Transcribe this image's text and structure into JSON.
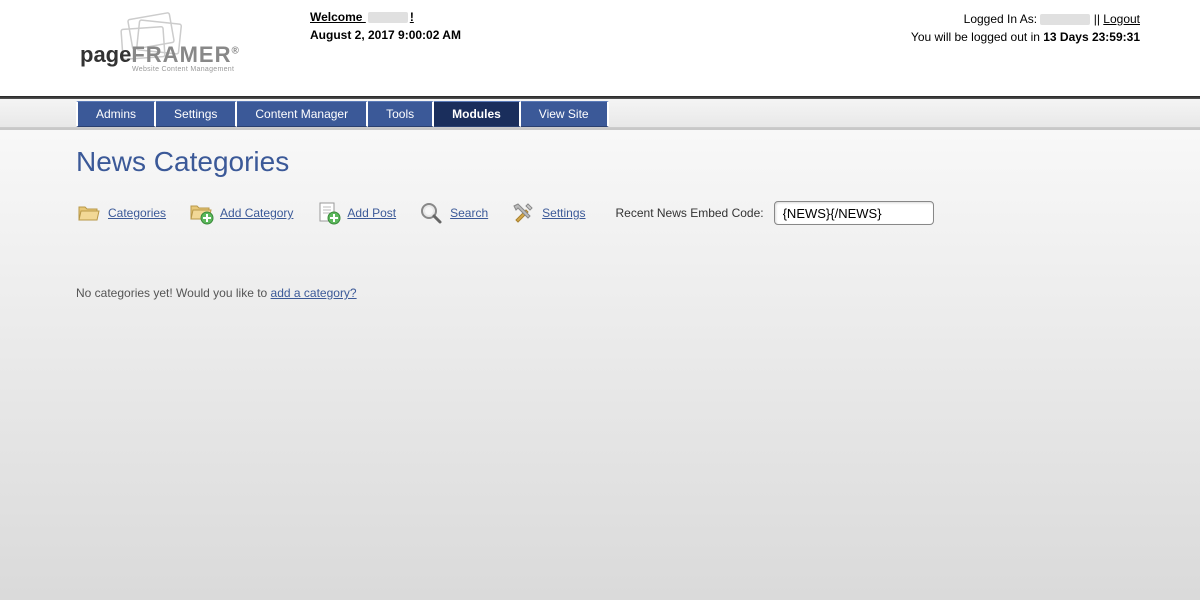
{
  "header": {
    "welcome_prefix": "Welcome ",
    "welcome_suffix": "!",
    "date_time": "August 2, 2017 9:00:02 AM",
    "logged_in_prefix": "Logged In As: ",
    "separator": " || ",
    "logout_label": "Logout",
    "session_prefix": "You will be logged out in ",
    "session_remaining": "13 Days 23:59:31",
    "logo_sub": "Website Content Management"
  },
  "nav": {
    "tabs": [
      {
        "label": "Admins"
      },
      {
        "label": "Settings"
      },
      {
        "label": "Content Manager"
      },
      {
        "label": "Tools"
      },
      {
        "label": "Modules",
        "active": true
      },
      {
        "label": "View Site"
      }
    ]
  },
  "page": {
    "title": "News Categories",
    "toolbar": {
      "categories": "Categories",
      "add_category": "Add Category",
      "add_post": "Add Post",
      "search": "Search",
      "settings": "Settings",
      "embed_label": "Recent News Embed Code:",
      "embed_value": "{NEWS}{/NEWS}"
    },
    "empty_prefix": "No categories yet! Would you like to ",
    "empty_link": "add a category?"
  }
}
